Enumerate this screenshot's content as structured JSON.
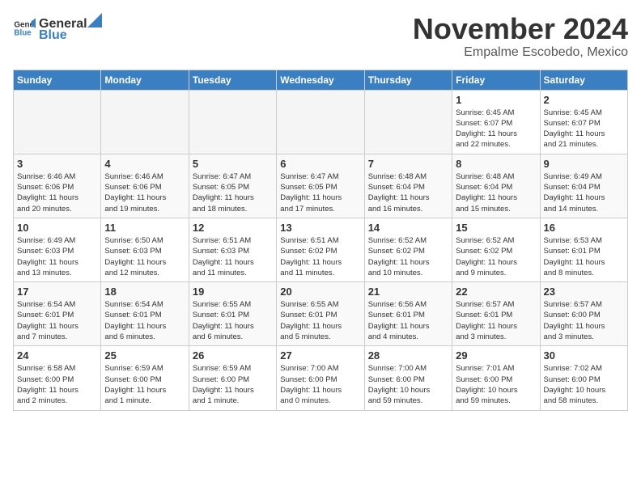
{
  "header": {
    "logo_general": "General",
    "logo_blue": "Blue",
    "title": "November 2024",
    "subtitle": "Empalme Escobedo, Mexico"
  },
  "columns": [
    "Sunday",
    "Monday",
    "Tuesday",
    "Wednesday",
    "Thursday",
    "Friday",
    "Saturday"
  ],
  "weeks": [
    [
      {
        "day": "",
        "info": ""
      },
      {
        "day": "",
        "info": ""
      },
      {
        "day": "",
        "info": ""
      },
      {
        "day": "",
        "info": ""
      },
      {
        "day": "",
        "info": ""
      },
      {
        "day": "1",
        "info": "Sunrise: 6:45 AM\nSunset: 6:07 PM\nDaylight: 11 hours\nand 22 minutes."
      },
      {
        "day": "2",
        "info": "Sunrise: 6:45 AM\nSunset: 6:07 PM\nDaylight: 11 hours\nand 21 minutes."
      }
    ],
    [
      {
        "day": "3",
        "info": "Sunrise: 6:46 AM\nSunset: 6:06 PM\nDaylight: 11 hours\nand 20 minutes."
      },
      {
        "day": "4",
        "info": "Sunrise: 6:46 AM\nSunset: 6:06 PM\nDaylight: 11 hours\nand 19 minutes."
      },
      {
        "day": "5",
        "info": "Sunrise: 6:47 AM\nSunset: 6:05 PM\nDaylight: 11 hours\nand 18 minutes."
      },
      {
        "day": "6",
        "info": "Sunrise: 6:47 AM\nSunset: 6:05 PM\nDaylight: 11 hours\nand 17 minutes."
      },
      {
        "day": "7",
        "info": "Sunrise: 6:48 AM\nSunset: 6:04 PM\nDaylight: 11 hours\nand 16 minutes."
      },
      {
        "day": "8",
        "info": "Sunrise: 6:48 AM\nSunset: 6:04 PM\nDaylight: 11 hours\nand 15 minutes."
      },
      {
        "day": "9",
        "info": "Sunrise: 6:49 AM\nSunset: 6:04 PM\nDaylight: 11 hours\nand 14 minutes."
      }
    ],
    [
      {
        "day": "10",
        "info": "Sunrise: 6:49 AM\nSunset: 6:03 PM\nDaylight: 11 hours\nand 13 minutes."
      },
      {
        "day": "11",
        "info": "Sunrise: 6:50 AM\nSunset: 6:03 PM\nDaylight: 11 hours\nand 12 minutes."
      },
      {
        "day": "12",
        "info": "Sunrise: 6:51 AM\nSunset: 6:03 PM\nDaylight: 11 hours\nand 11 minutes."
      },
      {
        "day": "13",
        "info": "Sunrise: 6:51 AM\nSunset: 6:02 PM\nDaylight: 11 hours\nand 11 minutes."
      },
      {
        "day": "14",
        "info": "Sunrise: 6:52 AM\nSunset: 6:02 PM\nDaylight: 11 hours\nand 10 minutes."
      },
      {
        "day": "15",
        "info": "Sunrise: 6:52 AM\nSunset: 6:02 PM\nDaylight: 11 hours\nand 9 minutes."
      },
      {
        "day": "16",
        "info": "Sunrise: 6:53 AM\nSunset: 6:01 PM\nDaylight: 11 hours\nand 8 minutes."
      }
    ],
    [
      {
        "day": "17",
        "info": "Sunrise: 6:54 AM\nSunset: 6:01 PM\nDaylight: 11 hours\nand 7 minutes."
      },
      {
        "day": "18",
        "info": "Sunrise: 6:54 AM\nSunset: 6:01 PM\nDaylight: 11 hours\nand 6 minutes."
      },
      {
        "day": "19",
        "info": "Sunrise: 6:55 AM\nSunset: 6:01 PM\nDaylight: 11 hours\nand 6 minutes."
      },
      {
        "day": "20",
        "info": "Sunrise: 6:55 AM\nSunset: 6:01 PM\nDaylight: 11 hours\nand 5 minutes."
      },
      {
        "day": "21",
        "info": "Sunrise: 6:56 AM\nSunset: 6:01 PM\nDaylight: 11 hours\nand 4 minutes."
      },
      {
        "day": "22",
        "info": "Sunrise: 6:57 AM\nSunset: 6:01 PM\nDaylight: 11 hours\nand 3 minutes."
      },
      {
        "day": "23",
        "info": "Sunrise: 6:57 AM\nSunset: 6:00 PM\nDaylight: 11 hours\nand 3 minutes."
      }
    ],
    [
      {
        "day": "24",
        "info": "Sunrise: 6:58 AM\nSunset: 6:00 PM\nDaylight: 11 hours\nand 2 minutes."
      },
      {
        "day": "25",
        "info": "Sunrise: 6:59 AM\nSunset: 6:00 PM\nDaylight: 11 hours\nand 1 minute."
      },
      {
        "day": "26",
        "info": "Sunrise: 6:59 AM\nSunset: 6:00 PM\nDaylight: 11 hours\nand 1 minute."
      },
      {
        "day": "27",
        "info": "Sunrise: 7:00 AM\nSunset: 6:00 PM\nDaylight: 11 hours\nand 0 minutes."
      },
      {
        "day": "28",
        "info": "Sunrise: 7:00 AM\nSunset: 6:00 PM\nDaylight: 10 hours\nand 59 minutes."
      },
      {
        "day": "29",
        "info": "Sunrise: 7:01 AM\nSunset: 6:00 PM\nDaylight: 10 hours\nand 59 minutes."
      },
      {
        "day": "30",
        "info": "Sunrise: 7:02 AM\nSunset: 6:00 PM\nDaylight: 10 hours\nand 58 minutes."
      }
    ]
  ]
}
